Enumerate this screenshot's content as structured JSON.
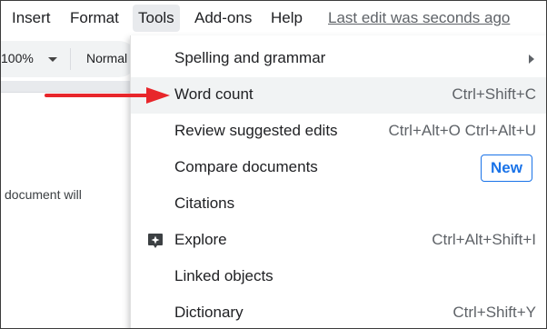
{
  "menubar": {
    "items": [
      {
        "label": "Insert"
      },
      {
        "label": "Format"
      },
      {
        "label": "Tools"
      },
      {
        "label": "Add-ons"
      },
      {
        "label": "Help"
      }
    ],
    "last_edit": "Last edit was seconds ago"
  },
  "toolbar": {
    "zoom": "100%",
    "style": "Normal"
  },
  "document": {
    "visible_text": "document will"
  },
  "tools_menu": {
    "items": [
      {
        "label": "Spelling and grammar",
        "has_submenu": true
      },
      {
        "label": "Word count",
        "shortcut": "Ctrl+Shift+C",
        "highlighted": true
      },
      {
        "label": "Review suggested edits",
        "shortcut": "Ctrl+Alt+O Ctrl+Alt+U"
      },
      {
        "label": "Compare documents",
        "badge": "New"
      },
      {
        "label": "Citations"
      },
      {
        "label": "Explore",
        "shortcut": "Ctrl+Alt+Shift+I",
        "icon": "explore-icon"
      },
      {
        "label": "Linked objects"
      },
      {
        "label": "Dictionary",
        "shortcut": "Ctrl+Shift+Y"
      }
    ]
  },
  "colors": {
    "accent": "#1a73e8",
    "arrow": "#e8262b",
    "highlight": "#f1f3f4"
  }
}
